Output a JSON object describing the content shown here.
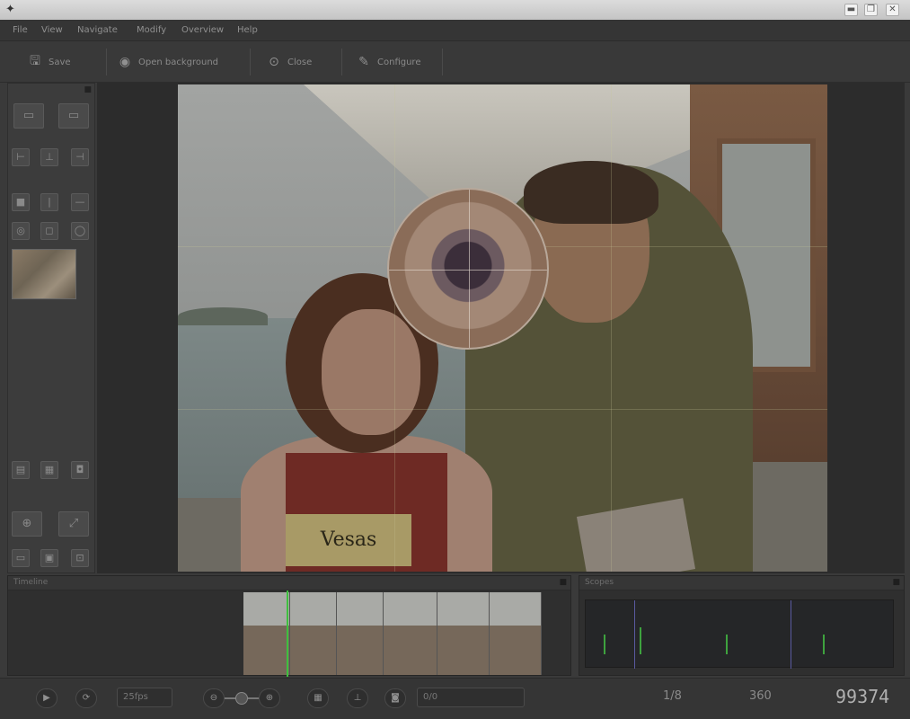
{
  "window": {
    "title": "",
    "logo_glyph": "✦",
    "controls": [
      {
        "name": "minimize-button",
        "glyph": "▬"
      },
      {
        "name": "maximize-button",
        "glyph": "❐"
      },
      {
        "name": "close-button",
        "glyph": "✕"
      }
    ]
  },
  "menu": {
    "items": [
      "File",
      "View",
      "Navigate",
      "Modify",
      "Overview",
      "Help"
    ]
  },
  "toolbar": {
    "buttons": [
      {
        "name": "save-button",
        "icon": "save-icon",
        "glyph": "🖫",
        "label": "Save"
      },
      {
        "name": "open-background-button",
        "icon": "open-icon",
        "glyph": "◉",
        "label": "Open background"
      },
      {
        "name": "close-file-button",
        "icon": "close-circle-icon",
        "glyph": "⊙",
        "label": "Close"
      },
      {
        "name": "configure-button",
        "icon": "wrench-icon",
        "glyph": "✎",
        "label": "Configure"
      }
    ]
  },
  "left_panel": {
    "icons": [
      {
        "name": "view-single-icon",
        "glyph": "▭"
      },
      {
        "name": "view-compare-icon",
        "glyph": "▭"
      },
      {
        "name": "align-left-icon",
        "glyph": "⊢"
      },
      {
        "name": "align-center-icon",
        "glyph": "⊥"
      },
      {
        "name": "align-right-icon",
        "glyph": "⊣"
      },
      {
        "name": "stop-icon",
        "glyph": "■"
      },
      {
        "name": "split-icon",
        "glyph": "|"
      },
      {
        "name": "minus-icon",
        "glyph": "—"
      },
      {
        "name": "target-icon",
        "glyph": "◎"
      },
      {
        "name": "frame-icon",
        "glyph": "◻"
      },
      {
        "name": "circle-icon",
        "glyph": "◯"
      },
      {
        "name": "film-icon",
        "glyph": "▤"
      },
      {
        "name": "gallery-icon",
        "glyph": "▦"
      },
      {
        "name": "camera-icon",
        "glyph": "◘"
      },
      {
        "name": "zoom-icon",
        "glyph": "⊕"
      },
      {
        "name": "fit-icon",
        "glyph": "⤢"
      },
      {
        "name": "screen-icon",
        "glyph": "▭"
      },
      {
        "name": "monitor-icon",
        "glyph": "▣"
      },
      {
        "name": "export-icon",
        "glyph": "⊡"
      }
    ]
  },
  "video": {
    "sign_text": "Vesas"
  },
  "timeline": {
    "header": "Timeline"
  },
  "histogram": {
    "header": "Scopes"
  },
  "statusbar": {
    "play_glyph": "▶",
    "loop_glyph": "⟳",
    "speed_label": "25fps",
    "zoom_out_glyph": "⊖",
    "zoom_in_glyph": "⊕",
    "tool_glyphs": [
      "▦",
      "⊥",
      "◙"
    ],
    "position_value": "0/0",
    "fraction_text": "1/8",
    "fps_text": "360",
    "frame_counter": "99374"
  },
  "colors": {
    "playhead": "#3fbf3f",
    "histogram_bars": "#3ea23e",
    "background": "#3a3a3a"
  }
}
